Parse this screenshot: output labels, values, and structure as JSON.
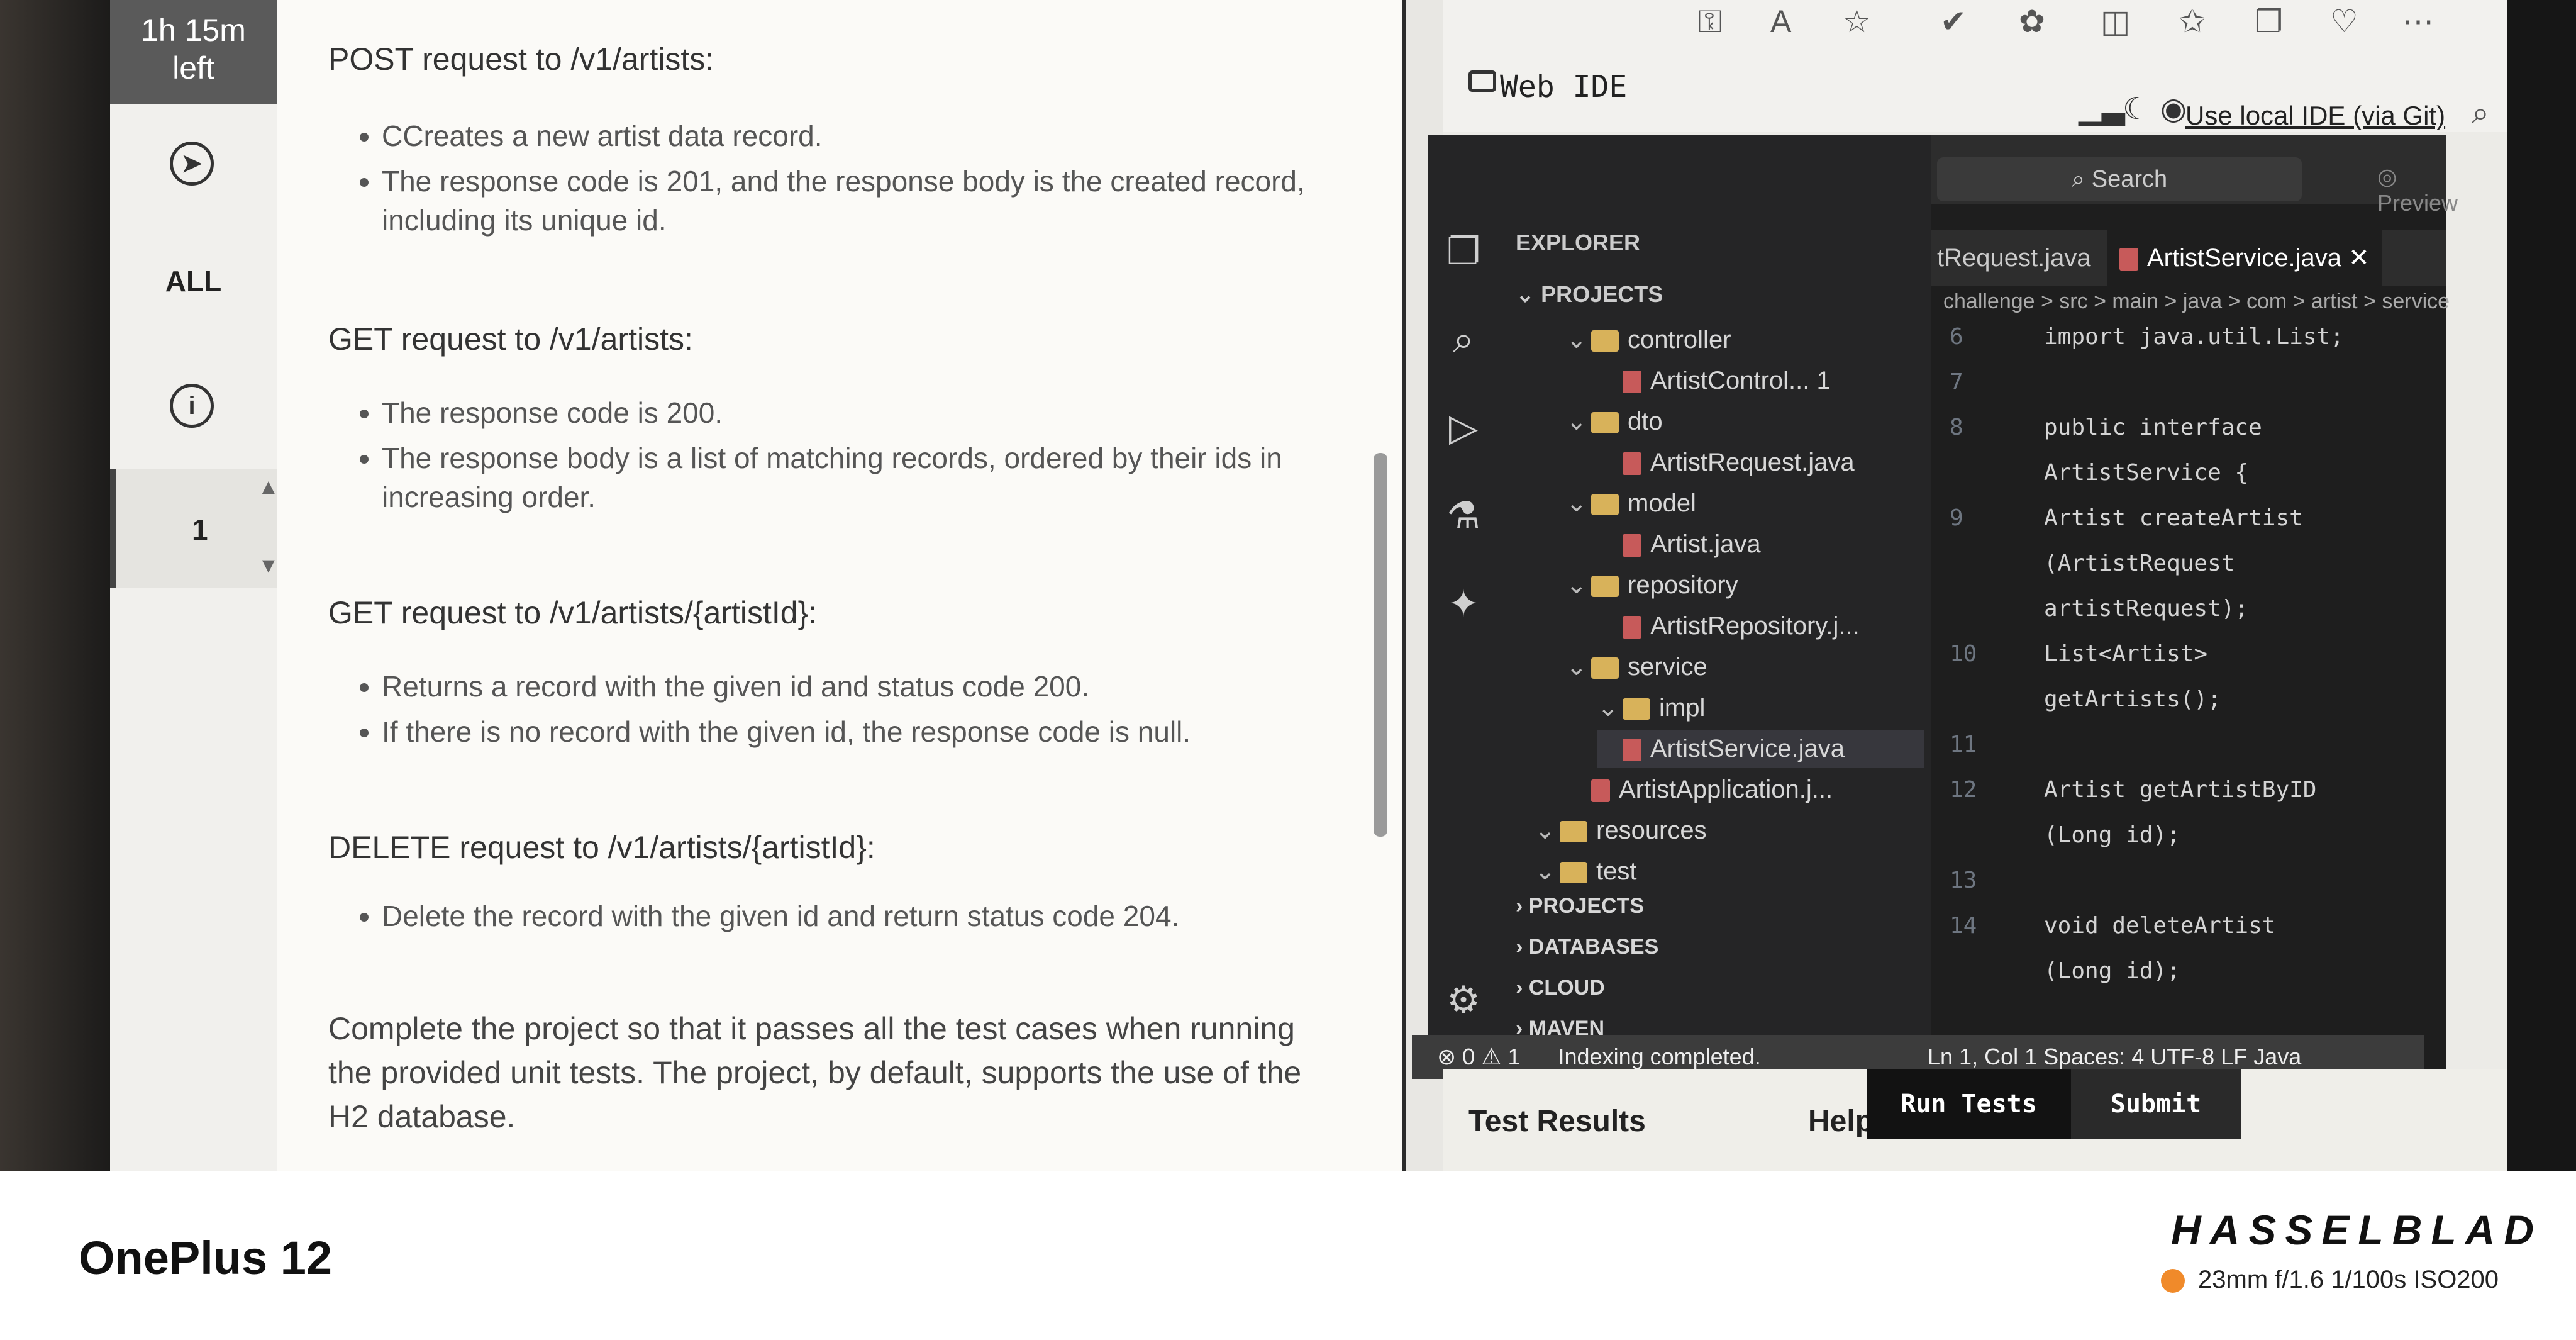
{
  "timer": {
    "line1": "1h 15m",
    "line2": "left"
  },
  "rail": {
    "all": "ALL",
    "number": "1"
  },
  "description": {
    "post_title": "POST request to /v1/artists:",
    "post_items": [
      "CCreates a new artist data record.",
      "The response code is 201, and the response body is the created record, including its unique id."
    ],
    "get_title": "GET request to /v1/artists:",
    "get_items": [
      "The response code is 200.",
      "The response body is a list of matching records, ordered by their ids in increasing order."
    ],
    "getid_title": "GET request to /v1/artists/{artistId}:",
    "getid_items": [
      "Returns a record with the given id and status code 200.",
      "If there is no record with the given id, the response code is null."
    ],
    "delete_title": "DELETE request to /v1/artists/{artistId}:",
    "delete_items": [
      "Delete the record with the given id and return status code 204."
    ],
    "complete_text": "Complete the project so that it passes all the test cases when running the provided unit tests. The project, by default, supports the use of the H2 database."
  },
  "ide_header": {
    "title": "Web IDE",
    "use_local": "Use local IDE (via Git)"
  },
  "ide": {
    "search": "Search",
    "preview": "Preview",
    "explorer": "EXPLORER",
    "projects": "PROJECTS",
    "tree": [
      {
        "label": "controller",
        "kind": "folder",
        "depth": 1
      },
      {
        "label": "ArtistControl... 1",
        "kind": "file",
        "depth": 2
      },
      {
        "label": "dto",
        "kind": "folder",
        "depth": 1
      },
      {
        "label": "ArtistRequest.java",
        "kind": "file",
        "depth": 2
      },
      {
        "label": "model",
        "kind": "folder",
        "depth": 1
      },
      {
        "label": "Artist.java",
        "kind": "file",
        "depth": 2
      },
      {
        "label": "repository",
        "kind": "folder",
        "depth": 1
      },
      {
        "label": "ArtistRepository.j...",
        "kind": "file",
        "depth": 2
      },
      {
        "label": "service",
        "kind": "folder",
        "depth": 1
      },
      {
        "label": "impl",
        "kind": "folder",
        "depth": 2
      },
      {
        "label": "ArtistService.java",
        "kind": "file",
        "depth": 2
      },
      {
        "label": "ArtistApplication.j...",
        "kind": "file",
        "depth": 1
      },
      {
        "label": "resources",
        "kind": "folder",
        "depth": 0
      },
      {
        "label": "test",
        "kind": "folder",
        "depth": 0
      }
    ],
    "sections": [
      "PROJECTS",
      "DATABASES",
      "CLOUD",
      "MAVEN"
    ],
    "tab_inactive": "tRequest.java",
    "tab_active": "ArtistService.java",
    "breadcrumb": "challenge > src > main > java > com > artist > service",
    "code": [
      {
        "n": "6",
        "t": "import java.util.List;"
      },
      {
        "n": "7",
        "t": ""
      },
      {
        "n": "8",
        "t": "public interface"
      },
      {
        "n": "",
        "t": "ArtistService {"
      },
      {
        "n": "9",
        "t": "    Artist createArtist"
      },
      {
        "n": "",
        "t": "    (ArtistRequest"
      },
      {
        "n": "",
        "t": "    artistRequest);"
      },
      {
        "n": "10",
        "t": "    List<Artist>"
      },
      {
        "n": "",
        "t": "    getArtists();"
      },
      {
        "n": "11",
        "t": ""
      },
      {
        "n": "12",
        "t": "    Artist getArtistByID"
      },
      {
        "n": "",
        "t": "    (Long id);"
      },
      {
        "n": "13",
        "t": ""
      },
      {
        "n": "14",
        "t": "    void deleteArtist"
      },
      {
        "n": "",
        "t": "    (Long id);"
      }
    ],
    "status_left": "⊗ 0 ⚠ 1",
    "status_msg": "Indexing completed.",
    "status_right": "Ln 1, Col 1   Spaces: 4   UTF-8   LF   Java"
  },
  "bottom": {
    "test_results": "Test Results",
    "help": "Help",
    "run_tests": "Run Tests",
    "submit": "Submit"
  },
  "footer": {
    "device": "OnePlus 12",
    "brand": "HASSELBLAD",
    "exif": "23mm  f/1.6  1/100s  ISO200",
    "accent": "#f08a2a"
  }
}
